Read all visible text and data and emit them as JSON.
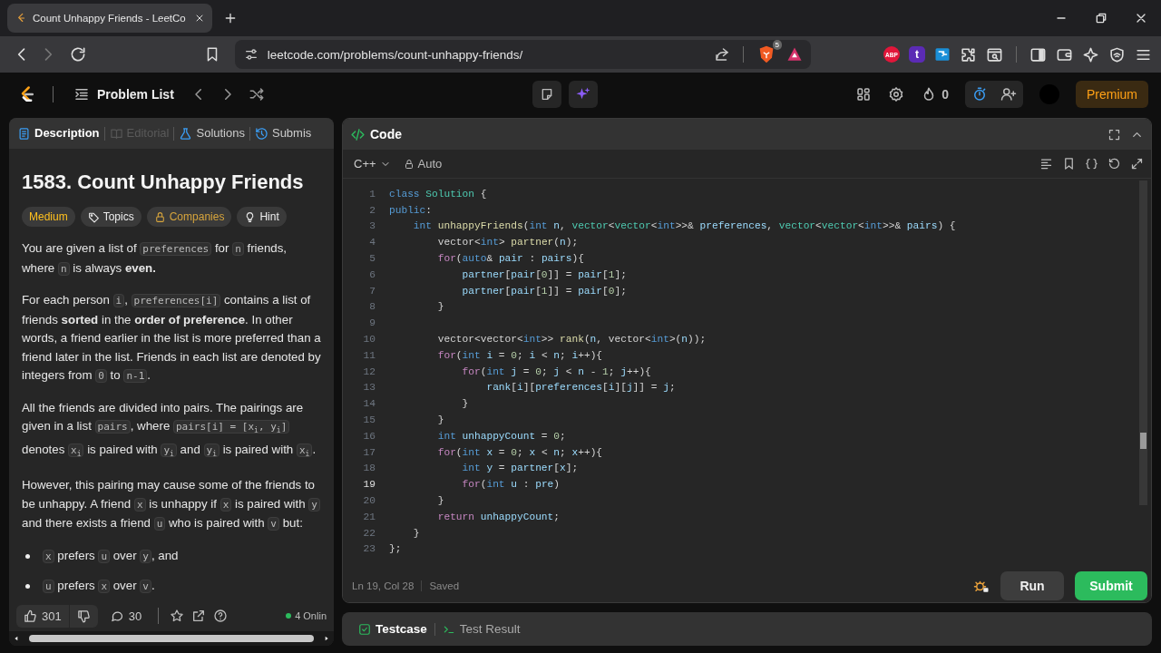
{
  "browser": {
    "tab": {
      "title": "Count Unhappy Friends - LeetCo"
    },
    "url": "leetcode.com/problems/count-unhappy-friends/",
    "shield_badge": "5",
    "extensions": [
      {
        "kind": "abp",
        "label": "ABP"
      },
      {
        "kind": "letter",
        "label": "t"
      }
    ]
  },
  "navbar": {
    "problem_list": "Problem List",
    "streak": "0",
    "premium": "Premium"
  },
  "description": {
    "tabs": [
      {
        "label": "Description",
        "selected": true,
        "disabled": false
      },
      {
        "label": "Editorial",
        "selected": false,
        "disabled": true
      },
      {
        "label": "Solutions",
        "selected": false,
        "disabled": false
      },
      {
        "label": "Submis",
        "selected": false,
        "disabled": false
      }
    ],
    "title": "1583. Count Unhappy Friends",
    "tags": [
      {
        "kind": "difficulty",
        "label": "Medium"
      },
      {
        "kind": "topics",
        "label": "Topics"
      },
      {
        "kind": "companies",
        "label": "Companies"
      },
      {
        "kind": "hint",
        "label": "Hint"
      }
    ],
    "paragraphs": [
      [
        {
          "kind": "text",
          "text": "You are given a list of "
        },
        {
          "kind": "code",
          "text": "preferences"
        },
        {
          "kind": "text",
          "text": " for "
        },
        {
          "kind": "code",
          "text": "n"
        },
        {
          "kind": "text",
          "text": " friends, where "
        },
        {
          "kind": "code",
          "text": "n"
        },
        {
          "kind": "text",
          "text": " is always **even.**"
        }
      ],
      [
        {
          "kind": "text",
          "text": "For each person "
        },
        {
          "kind": "code",
          "text": "i"
        },
        {
          "kind": "text",
          "text": ", "
        },
        {
          "kind": "code",
          "text": "preferences[i]"
        },
        {
          "kind": "text",
          "text": " contains a list of friends **sorted** in the **order of preference**. In other words, a friend earlier in the list is more preferred than a friend later in the list. Friends in each list are denoted by integers from "
        },
        {
          "kind": "code",
          "text": "0"
        },
        {
          "kind": "text",
          "text": " to "
        },
        {
          "kind": "code",
          "text": "n-1"
        },
        {
          "kind": "text",
          "text": "."
        }
      ],
      [
        {
          "kind": "text",
          "text": "All the friends are divided into pairs. The pairings are given in a list "
        },
        {
          "kind": "code",
          "text": "pairs"
        },
        {
          "kind": "text",
          "text": ", where "
        },
        {
          "kind": "code",
          "text": "pairs[i] = [x$_{i}$, y$_{i}$]"
        },
        {
          "kind": "text",
          "text": " denotes "
        },
        {
          "kind": "code",
          "text": "x$_{i}$"
        },
        {
          "kind": "text",
          "text": " is paired with "
        },
        {
          "kind": "code",
          "text": "y$_{i}$"
        },
        {
          "kind": "text",
          "text": " and "
        },
        {
          "kind": "code",
          "text": "y$_{i}$"
        },
        {
          "kind": "text",
          "text": " is paired with "
        },
        {
          "kind": "code",
          "text": "x$_{i}$"
        },
        {
          "kind": "text",
          "text": "."
        }
      ],
      [
        {
          "kind": "text",
          "text": "However, this pairing may cause some of the friends to be unhappy. A friend "
        },
        {
          "kind": "code",
          "text": "x"
        },
        {
          "kind": "text",
          "text": " is unhappy if "
        },
        {
          "kind": "code",
          "text": "x"
        },
        {
          "kind": "text",
          "text": " is paired with "
        },
        {
          "kind": "code",
          "text": "y"
        },
        {
          "kind": "text",
          "text": " and there exists a friend "
        },
        {
          "kind": "code",
          "text": "u"
        },
        {
          "kind": "text",
          "text": " who is paired with "
        },
        {
          "kind": "code",
          "text": "v"
        },
        {
          "kind": "text",
          "text": " but:"
        }
      ]
    ],
    "bullets": [
      [
        {
          "kind": "code",
          "text": "x"
        },
        {
          "kind": "text",
          "text": " prefers "
        },
        {
          "kind": "code",
          "text": "u"
        },
        {
          "kind": "text",
          "text": " over "
        },
        {
          "kind": "code",
          "text": "y"
        },
        {
          "kind": "text",
          "text": ", and"
        }
      ],
      [
        {
          "kind": "code",
          "text": "u"
        },
        {
          "kind": "text",
          "text": " prefers "
        },
        {
          "kind": "code",
          "text": "x"
        },
        {
          "kind": "text",
          "text": " over "
        },
        {
          "kind": "code",
          "text": "v"
        },
        {
          "kind": "text",
          "text": "."
        }
      ]
    ],
    "footer": {
      "likes": "301",
      "comments": "30",
      "online": "4 Onlin"
    }
  },
  "editor": {
    "title": "Code",
    "language": "C++",
    "mode": "Auto",
    "lines": [
      {
        "n": "1",
        "current": false,
        "tokens": [
          {
            "kind": "kw",
            "text": "class "
          },
          {
            "kind": "type",
            "text": "Solution"
          },
          {
            "kind": "p",
            "text": " {"
          }
        ]
      },
      {
        "n": "2",
        "current": false,
        "tokens": [
          {
            "kind": "kw",
            "text": "public"
          },
          {
            "kind": "p",
            "text": ":"
          }
        ]
      },
      {
        "n": "3",
        "current": false,
        "tokens": [
          {
            "kind": "kw",
            "text": "    int "
          },
          {
            "kind": "fn",
            "text": "unhappyFriends"
          },
          {
            "kind": "p",
            "text": "("
          },
          {
            "kind": "kw",
            "text": "int "
          },
          {
            "kind": "var",
            "text": "n"
          },
          {
            "kind": "p",
            "text": ", "
          },
          {
            "kind": "type",
            "text": "vector"
          },
          {
            "kind": "p",
            "text": "<"
          },
          {
            "kind": "type",
            "text": "vector"
          },
          {
            "kind": "p",
            "text": "<"
          },
          {
            "kind": "kw",
            "text": "int"
          },
          {
            "kind": "p",
            "text": ">>& "
          },
          {
            "kind": "var",
            "text": "preferences"
          },
          {
            "kind": "p",
            "text": ", "
          },
          {
            "kind": "type",
            "text": "vector"
          },
          {
            "kind": "p",
            "text": "<"
          },
          {
            "kind": "type",
            "text": "vector"
          },
          {
            "kind": "p",
            "text": "<"
          },
          {
            "kind": "kw",
            "text": "int"
          },
          {
            "kind": "p",
            "text": ">>& "
          },
          {
            "kind": "var",
            "text": "pairs"
          },
          {
            "kind": "p",
            "text": ") {"
          }
        ]
      },
      {
        "n": "4",
        "current": false,
        "tokens": [
          {
            "kind": "p",
            "text": "        vector<"
          },
          {
            "kind": "kw",
            "text": "int"
          },
          {
            "kind": "p",
            "text": "> "
          },
          {
            "kind": "fn",
            "text": "partner"
          },
          {
            "kind": "p",
            "text": "("
          },
          {
            "kind": "var",
            "text": "n"
          },
          {
            "kind": "p",
            "text": ");"
          }
        ]
      },
      {
        "n": "5",
        "current": false,
        "tokens": [
          {
            "kind": "ctl",
            "text": "        for"
          },
          {
            "kind": "p",
            "text": "("
          },
          {
            "kind": "kw",
            "text": "auto"
          },
          {
            "kind": "p",
            "text": "& "
          },
          {
            "kind": "var",
            "text": "pair"
          },
          {
            "kind": "p",
            "text": " : "
          },
          {
            "kind": "var",
            "text": "pairs"
          },
          {
            "kind": "p",
            "text": "){"
          }
        ]
      },
      {
        "n": "6",
        "current": false,
        "tokens": [
          {
            "kind": "var",
            "text": "            partner"
          },
          {
            "kind": "p",
            "text": "["
          },
          {
            "kind": "var",
            "text": "pair"
          },
          {
            "kind": "p",
            "text": "["
          },
          {
            "kind": "num",
            "text": "0"
          },
          {
            "kind": "p",
            "text": "]] = "
          },
          {
            "kind": "var",
            "text": "pair"
          },
          {
            "kind": "p",
            "text": "["
          },
          {
            "kind": "num",
            "text": "1"
          },
          {
            "kind": "p",
            "text": "];"
          }
        ]
      },
      {
        "n": "7",
        "current": false,
        "tokens": [
          {
            "kind": "var",
            "text": "            partner"
          },
          {
            "kind": "p",
            "text": "["
          },
          {
            "kind": "var",
            "text": "pair"
          },
          {
            "kind": "p",
            "text": "["
          },
          {
            "kind": "num",
            "text": "1"
          },
          {
            "kind": "p",
            "text": "]] = "
          },
          {
            "kind": "var",
            "text": "pair"
          },
          {
            "kind": "p",
            "text": "["
          },
          {
            "kind": "num",
            "text": "0"
          },
          {
            "kind": "p",
            "text": "];"
          }
        ]
      },
      {
        "n": "8",
        "current": false,
        "tokens": [
          {
            "kind": "p",
            "text": "        }"
          }
        ]
      },
      {
        "n": "9",
        "current": false
      },
      {
        "n": "10",
        "current": false,
        "tokens": [
          {
            "kind": "p",
            "text": "        vector<vector<"
          },
          {
            "kind": "kw",
            "text": "int"
          },
          {
            "kind": "p",
            "text": ">> "
          },
          {
            "kind": "fn",
            "text": "rank"
          },
          {
            "kind": "p",
            "text": "("
          },
          {
            "kind": "var",
            "text": "n"
          },
          {
            "kind": "p",
            "text": ", vector<"
          },
          {
            "kind": "kw",
            "text": "int"
          },
          {
            "kind": "p",
            "text": ">("
          },
          {
            "kind": "var",
            "text": "n"
          },
          {
            "kind": "p",
            "text": "));"
          }
        ]
      },
      {
        "n": "11",
        "current": false,
        "tokens": [
          {
            "kind": "ctl",
            "text": "        for"
          },
          {
            "kind": "p",
            "text": "("
          },
          {
            "kind": "kw",
            "text": "int "
          },
          {
            "kind": "var",
            "text": "i"
          },
          {
            "kind": "p",
            "text": " = "
          },
          {
            "kind": "num",
            "text": "0"
          },
          {
            "kind": "p",
            "text": "; "
          },
          {
            "kind": "var",
            "text": "i"
          },
          {
            "kind": "p",
            "text": " < "
          },
          {
            "kind": "var",
            "text": "n"
          },
          {
            "kind": "p",
            "text": "; "
          },
          {
            "kind": "var",
            "text": "i"
          },
          {
            "kind": "p",
            "text": "++){"
          }
        ]
      },
      {
        "n": "12",
        "current": false,
        "tokens": [
          {
            "kind": "ctl",
            "text": "            for"
          },
          {
            "kind": "p",
            "text": "("
          },
          {
            "kind": "kw",
            "text": "int "
          },
          {
            "kind": "var",
            "text": "j"
          },
          {
            "kind": "p",
            "text": " = "
          },
          {
            "kind": "num",
            "text": "0"
          },
          {
            "kind": "p",
            "text": "; "
          },
          {
            "kind": "var",
            "text": "j"
          },
          {
            "kind": "p",
            "text": " < "
          },
          {
            "kind": "var",
            "text": "n"
          },
          {
            "kind": "p",
            "text": " - "
          },
          {
            "kind": "num",
            "text": "1"
          },
          {
            "kind": "p",
            "text": "; "
          },
          {
            "kind": "var",
            "text": "j"
          },
          {
            "kind": "p",
            "text": "++){"
          }
        ]
      },
      {
        "n": "13",
        "current": false,
        "tokens": [
          {
            "kind": "var",
            "text": "                rank"
          },
          {
            "kind": "p",
            "text": "["
          },
          {
            "kind": "var",
            "text": "i"
          },
          {
            "kind": "p",
            "text": "]["
          },
          {
            "kind": "var",
            "text": "preferences"
          },
          {
            "kind": "p",
            "text": "["
          },
          {
            "kind": "var",
            "text": "i"
          },
          {
            "kind": "p",
            "text": "]["
          },
          {
            "kind": "var",
            "text": "j"
          },
          {
            "kind": "p",
            "text": "]] = "
          },
          {
            "kind": "var",
            "text": "j"
          },
          {
            "kind": "p",
            "text": ";"
          }
        ]
      },
      {
        "n": "14",
        "current": false,
        "tokens": [
          {
            "kind": "p",
            "text": "            }"
          }
        ]
      },
      {
        "n": "15",
        "current": false,
        "tokens": [
          {
            "kind": "p",
            "text": "        }"
          }
        ]
      },
      {
        "n": "16",
        "current": false,
        "tokens": [
          {
            "kind": "kw",
            "text": "        int "
          },
          {
            "kind": "var",
            "text": "unhappyCount"
          },
          {
            "kind": "p",
            "text": " = "
          },
          {
            "kind": "num",
            "text": "0"
          },
          {
            "kind": "p",
            "text": ";"
          }
        ]
      },
      {
        "n": "17",
        "current": false,
        "tokens": [
          {
            "kind": "ctl",
            "text": "        for"
          },
          {
            "kind": "p",
            "text": "("
          },
          {
            "kind": "kw",
            "text": "int "
          },
          {
            "kind": "var",
            "text": "x"
          },
          {
            "kind": "p",
            "text": " = "
          },
          {
            "kind": "num",
            "text": "0"
          },
          {
            "kind": "p",
            "text": "; "
          },
          {
            "kind": "var",
            "text": "x"
          },
          {
            "kind": "p",
            "text": " < "
          },
          {
            "kind": "var",
            "text": "n"
          },
          {
            "kind": "p",
            "text": "; "
          },
          {
            "kind": "var",
            "text": "x"
          },
          {
            "kind": "p",
            "text": "++){"
          }
        ]
      },
      {
        "n": "18",
        "current": false,
        "tokens": [
          {
            "kind": "kw",
            "text": "            int "
          },
          {
            "kind": "var",
            "text": "y"
          },
          {
            "kind": "p",
            "text": " = "
          },
          {
            "kind": "var",
            "text": "partner"
          },
          {
            "kind": "p",
            "text": "["
          },
          {
            "kind": "var",
            "text": "x"
          },
          {
            "kind": "p",
            "text": "];"
          }
        ]
      },
      {
        "n": "19",
        "current": true,
        "tokens": [
          {
            "kind": "ctl",
            "text": "            for"
          },
          {
            "kind": "p",
            "text": "("
          },
          {
            "kind": "kw",
            "text": "int "
          },
          {
            "kind": "var",
            "text": "u"
          },
          {
            "kind": "p",
            "text": " : "
          },
          {
            "kind": "var",
            "text": "pre"
          },
          {
            "kind": "p",
            "text": ")"
          }
        ]
      },
      {
        "n": "20",
        "current": false,
        "tokens": [
          {
            "kind": "p",
            "text": "        }"
          }
        ]
      },
      {
        "n": "21",
        "current": false,
        "tokens": [
          {
            "kind": "ctl",
            "text": "        return "
          },
          {
            "kind": "var",
            "text": "unhappyCount"
          },
          {
            "kind": "p",
            "text": ";"
          }
        ]
      },
      {
        "n": "22",
        "current": false,
        "tokens": [
          {
            "kind": "p",
            "text": "    }"
          }
        ]
      },
      {
        "n": "23",
        "current": false,
        "tokens": [
          {
            "kind": "p",
            "text": "};"
          }
        ]
      }
    ],
    "status": {
      "position": "Ln 19, Col 28",
      "saved": "Saved"
    },
    "buttons": {
      "run": "Run",
      "submit": "Submit"
    }
  },
  "console": {
    "tabs": [
      {
        "label": "Testcase",
        "selected": true
      },
      {
        "label": "Test Result",
        "selected": false
      }
    ]
  }
}
